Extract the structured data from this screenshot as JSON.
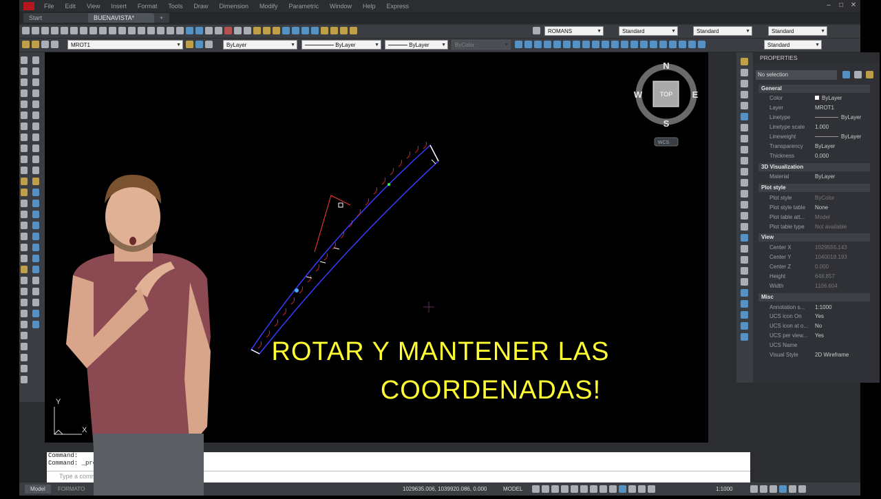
{
  "menu": [
    "File",
    "Edit",
    "View",
    "Insert",
    "Format",
    "Tools",
    "Draw",
    "Dimension",
    "Modify",
    "Parametric",
    "Window",
    "Help",
    "Express"
  ],
  "tabs": [
    {
      "label": "Start"
    },
    {
      "label": "BUENAVISTA*",
      "active": true
    },
    {
      "label": "+"
    }
  ],
  "toolbar1": {
    "text_style": "ROMANS",
    "dim_style": "Standard",
    "table_style": "Standard",
    "mleader_style": "Standard"
  },
  "toolbar2": {
    "layer": "MROT1",
    "color": "ByLayer",
    "linetype": "ByLayer",
    "lineweight": "ByLayer",
    "plotstyle": "ByColor",
    "visual": "Standard"
  },
  "navcube": {
    "n": "N",
    "s": "S",
    "e": "E",
    "w": "W",
    "face": "TOP",
    "wcs": "WCS"
  },
  "ucs": {
    "x": "X",
    "y": "Y"
  },
  "caption": {
    "line1": "ROTAR Y MANTENER LAS",
    "line2": "COORDENADAS!"
  },
  "properties": {
    "title": "PROPERTIES",
    "selection": "No selection",
    "sections": [
      {
        "name": "General",
        "rows": [
          {
            "k": "Color",
            "v": "ByLayer"
          },
          {
            "k": "Layer",
            "v": "MROT1"
          },
          {
            "k": "Linetype",
            "v": "ByLayer"
          },
          {
            "k": "Linetype scale",
            "v": "1.000"
          },
          {
            "k": "Lineweight",
            "v": "ByLayer"
          },
          {
            "k": "Transparency",
            "v": "ByLayer"
          },
          {
            "k": "Thickness",
            "v": "0.000"
          }
        ]
      },
      {
        "name": "3D Visualization",
        "rows": [
          {
            "k": "Material",
            "v": "ByLayer"
          }
        ]
      },
      {
        "name": "Plot style",
        "rows": [
          {
            "k": "Plot style",
            "v": "ByColor",
            "dim": true
          },
          {
            "k": "Plot style table",
            "v": "None"
          },
          {
            "k": "Plot table att...",
            "v": "Model",
            "dim": true
          },
          {
            "k": "Plot table type",
            "v": "Not available",
            "dim": true
          }
        ]
      },
      {
        "name": "View",
        "rows": [
          {
            "k": "Center X",
            "v": "1029556.143",
            "dim": true
          },
          {
            "k": "Center Y",
            "v": "1040018.193",
            "dim": true
          },
          {
            "k": "Center Z",
            "v": "0.000",
            "dim": true
          },
          {
            "k": "Height",
            "v": "648.857",
            "dim": true
          },
          {
            "k": "Width",
            "v": "1106.604",
            "dim": true
          }
        ]
      },
      {
        "name": "Misc",
        "rows": [
          {
            "k": "Annotation s...",
            "v": "1:1000"
          },
          {
            "k": "UCS icon On",
            "v": "Yes"
          },
          {
            "k": "UCS icon at o...",
            "v": "No"
          },
          {
            "k": "UCS per view...",
            "v": "Yes"
          },
          {
            "k": "UCS Name",
            "v": ""
          },
          {
            "k": "Visual Style",
            "v": "2D Wireframe"
          }
        ]
      }
    ]
  },
  "command": {
    "line1": "Command:",
    "line2": "Command: _properti",
    "placeholder": "Type a command"
  },
  "status": {
    "tab_model": "Model",
    "tab_layout": "FORMATO",
    "coords": "1029635.006, 1039920.086, 0.000",
    "model": "MODEL",
    "scale": "1:1000"
  }
}
